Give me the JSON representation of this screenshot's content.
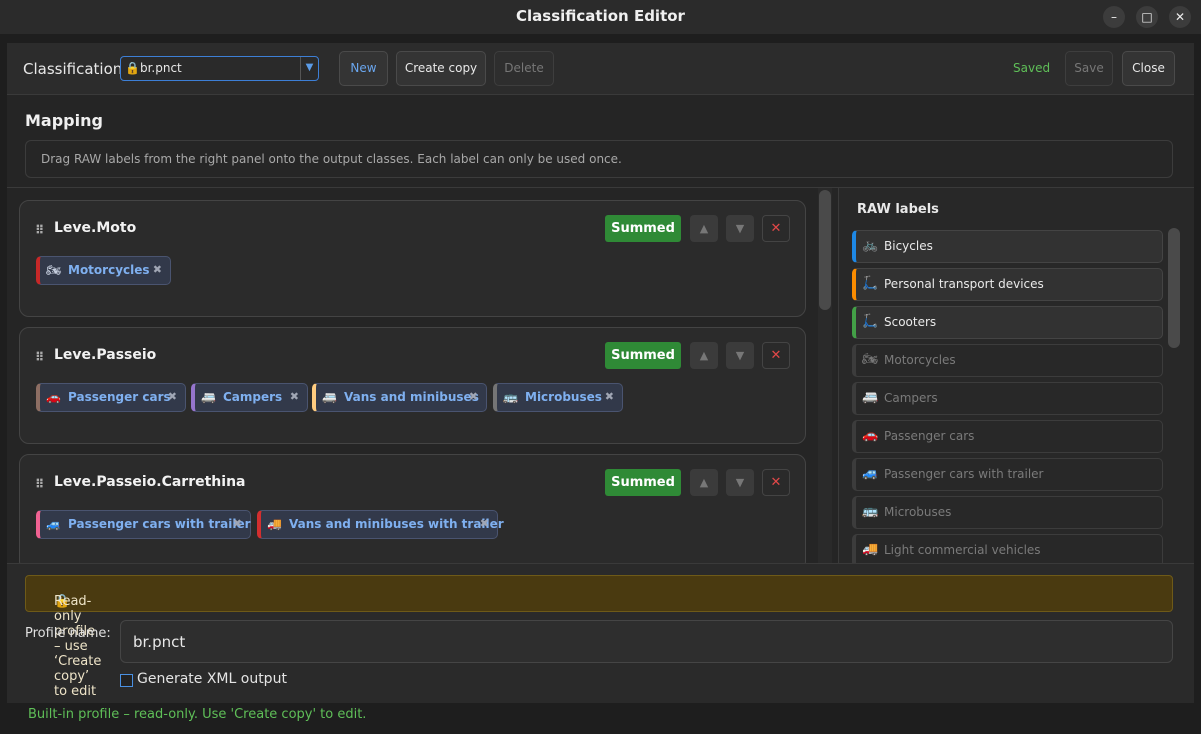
{
  "window": {
    "title": "Classification Editor"
  },
  "toolbar": {
    "classification_label": "Classification",
    "combo_value": "br.pnct",
    "new_label": "New",
    "create_copy_label": "Create copy",
    "delete_label": "Delete",
    "saved_text": "Saved",
    "save_label": "Save",
    "close_label": "Close"
  },
  "mapping": {
    "title": "Mapping",
    "hint": "Drag RAW labels from the right panel onto the output classes. Each label can only be used once."
  },
  "classes": [
    {
      "name": "Leve.Moto",
      "badge": "Summed",
      "labels": [
        {
          "text": "Motorcycles",
          "accent": "#c62828",
          "icon": "motorcycle-icon"
        }
      ]
    },
    {
      "name": "Leve.Passeio",
      "badge": "Summed",
      "labels": [
        {
          "text": "Passenger cars",
          "accent": "#8d6e63",
          "icon": "car-icon"
        },
        {
          "text": "Campers",
          "accent": "#9575cd",
          "icon": "camper-icon"
        },
        {
          "text": "Vans and minibuses",
          "accent": "#ffcc80",
          "icon": "van-icon"
        },
        {
          "text": "Microbuses",
          "accent": "#757575",
          "icon": "bus-icon"
        }
      ]
    },
    {
      "name": "Leve.Passeio.Carrethina",
      "badge": "Summed",
      "labels": [
        {
          "text": "Passenger cars with trailer",
          "accent": "#f06292",
          "icon": "car-trailer-icon"
        },
        {
          "text": "Vans and minibuses with trailer",
          "accent": "#d32f2f",
          "icon": "van-trailer-icon"
        }
      ]
    }
  ],
  "raw": {
    "title": "RAW labels",
    "items": [
      {
        "text": "Bicycles",
        "accent": "#1e88e5",
        "used": false,
        "icon": "bicycle-icon"
      },
      {
        "text": "Personal transport devices",
        "accent": "#fb8c00",
        "used": false,
        "icon": "scooter-icon"
      },
      {
        "text": "Scooters",
        "accent": "#43a047",
        "used": false,
        "icon": "kick-scooter-icon"
      },
      {
        "text": "Motorcycles",
        "accent": "#3c3c3c",
        "used": true,
        "icon": "motorcycle-icon"
      },
      {
        "text": "Campers",
        "accent": "#3c3c3c",
        "used": true,
        "icon": "camper-icon"
      },
      {
        "text": "Passenger cars",
        "accent": "#3c3c3c",
        "used": true,
        "icon": "car-icon"
      },
      {
        "text": "Passenger cars with trailer",
        "accent": "#3c3c3c",
        "used": true,
        "icon": "car-trailer-icon"
      },
      {
        "text": "Microbuses",
        "accent": "#3c3c3c",
        "used": true,
        "icon": "bus-icon"
      },
      {
        "text": "Light commercial vehicles",
        "accent": "#3c3c3c",
        "used": true,
        "icon": "truck-icon"
      }
    ]
  },
  "bottom": {
    "readonly_text": "Read-only profile – use ‘Create copy’ to edit",
    "profile_name_label": "Profile name:",
    "profile_name_value": "br.pnct",
    "generate_xml_label": "Generate XML output",
    "generate_xml_checked": false
  },
  "status": {
    "text": "Built-in profile – read-only. Use 'Create copy' to edit."
  }
}
